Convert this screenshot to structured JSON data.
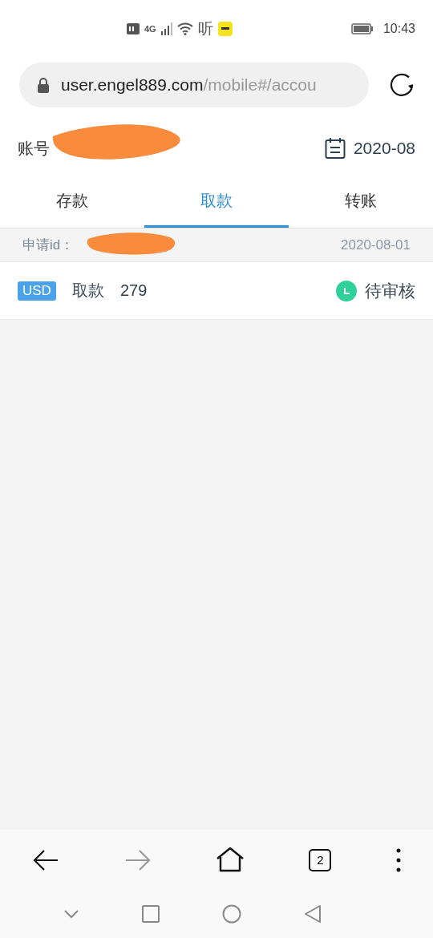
{
  "status_bar": {
    "network": "4G",
    "app_label": "听",
    "time": "10:43"
  },
  "browser": {
    "url_host": "user.engel889.com",
    "url_path": "/mobile#/accou",
    "tab_count": "2",
    "forward_disabled": true
  },
  "header": {
    "account_label": "账号",
    "month": "2020-08"
  },
  "tabs": [
    {
      "label": "存款",
      "selected": false
    },
    {
      "label": "取款",
      "selected": true
    },
    {
      "label": "转账",
      "selected": false
    }
  ],
  "records": [
    {
      "id_label": "申请id：",
      "date": "2020-08-01",
      "currency": "USD",
      "type": "取款",
      "amount": "279",
      "status": "待审核",
      "color": "#2fd19a"
    }
  ]
}
